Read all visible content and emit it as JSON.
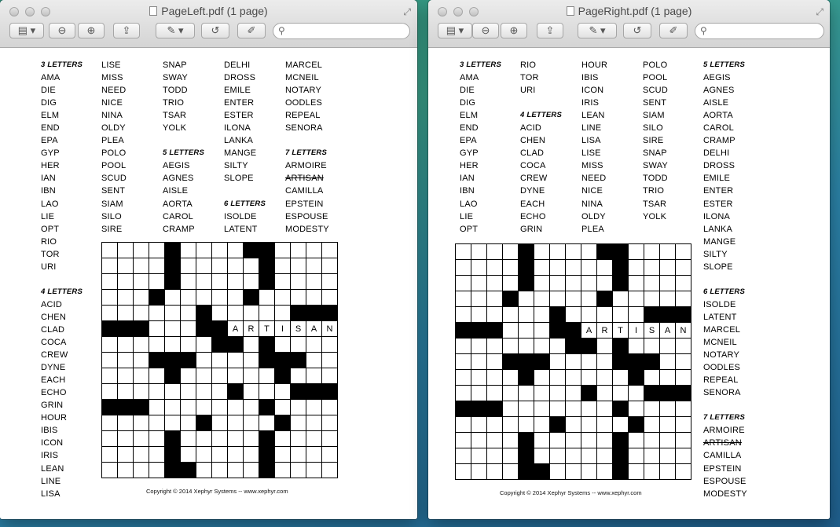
{
  "left_window": {
    "title": "PageLeft.pdf (1 page)",
    "columns": [
      [
        {
          "t": "3 LETTERS",
          "h": true
        },
        {
          "t": "AMA"
        },
        {
          "t": "DIE"
        },
        {
          "t": "DIG"
        },
        {
          "t": "ELM"
        },
        {
          "t": "END"
        },
        {
          "t": "EPA"
        },
        {
          "t": "GYP"
        },
        {
          "t": "HER"
        },
        {
          "t": "IAN"
        },
        {
          "t": "IBN"
        },
        {
          "t": "LAO"
        },
        {
          "t": "LIE"
        },
        {
          "t": "OPT"
        },
        {
          "t": "RIO"
        },
        {
          "t": "TOR"
        },
        {
          "t": "URI"
        },
        {
          "t": ""
        },
        {
          "t": "4 LETTERS",
          "h": true
        },
        {
          "t": "ACID"
        },
        {
          "t": "CHEN"
        },
        {
          "t": "CLAD"
        },
        {
          "t": "COCA"
        },
        {
          "t": "CREW"
        },
        {
          "t": "DYNE"
        },
        {
          "t": "EACH"
        },
        {
          "t": "ECHO"
        },
        {
          "t": "GRIN"
        },
        {
          "t": "HOUR"
        },
        {
          "t": "IBIS"
        },
        {
          "t": "ICON"
        },
        {
          "t": "IRIS"
        },
        {
          "t": "LEAN"
        },
        {
          "t": "LINE"
        },
        {
          "t": "LISA"
        }
      ],
      [
        {
          "t": "LISE"
        },
        {
          "t": "MISS"
        },
        {
          "t": "NEED"
        },
        {
          "t": "NICE"
        },
        {
          "t": "NINA"
        },
        {
          "t": "OLDY"
        },
        {
          "t": "PLEA"
        },
        {
          "t": "POLO"
        },
        {
          "t": "POOL"
        },
        {
          "t": "SCUD"
        },
        {
          "t": "SENT"
        },
        {
          "t": "SIAM"
        },
        {
          "t": "SILO"
        },
        {
          "t": "SIRE"
        }
      ],
      [
        {
          "t": "SNAP"
        },
        {
          "t": "SWAY"
        },
        {
          "t": "TODD"
        },
        {
          "t": "TRIO"
        },
        {
          "t": "TSAR"
        },
        {
          "t": "YOLK"
        },
        {
          "t": ""
        },
        {
          "t": "5 LETTERS",
          "h": true
        },
        {
          "t": "AEGIS"
        },
        {
          "t": "AGNES"
        },
        {
          "t": "AISLE"
        },
        {
          "t": "AORTA"
        },
        {
          "t": "CAROL"
        },
        {
          "t": "CRAMP"
        }
      ],
      [
        {
          "t": "DELHI"
        },
        {
          "t": "DROSS"
        },
        {
          "t": "EMILE"
        },
        {
          "t": "ENTER"
        },
        {
          "t": "ESTER"
        },
        {
          "t": "ILONA"
        },
        {
          "t": "LANKA"
        },
        {
          "t": "MANGE"
        },
        {
          "t": "SILTY"
        },
        {
          "t": "SLOPE"
        },
        {
          "t": ""
        },
        {
          "t": "6 LETTERS",
          "h": true
        },
        {
          "t": "ISOLDE"
        },
        {
          "t": "LATENT"
        }
      ],
      [
        {
          "t": "MARCEL"
        },
        {
          "t": "MCNEIL"
        },
        {
          "t": "NOTARY"
        },
        {
          "t": "OODLES"
        },
        {
          "t": "REPEAL"
        },
        {
          "t": "SENORA"
        },
        {
          "t": ""
        },
        {
          "t": "7 LETTERS",
          "h": true
        },
        {
          "t": "ARMOIRE"
        },
        {
          "t": "ARTISAN",
          "s": true
        },
        {
          "t": "CAMILLA"
        },
        {
          "t": "EPSTEIN"
        },
        {
          "t": "ESPOUSE"
        },
        {
          "t": "MODESTY"
        }
      ]
    ],
    "copyright": "Copyright © 2014 Xephyr Systems -- www.xephyr.com"
  },
  "right_window": {
    "title": "PageRight.pdf (1 page)",
    "columns": [
      [
        {
          "t": "3 LETTERS",
          "h": true
        },
        {
          "t": "AMA"
        },
        {
          "t": "DIE"
        },
        {
          "t": "DIG"
        },
        {
          "t": "ELM"
        },
        {
          "t": "END"
        },
        {
          "t": "EPA"
        },
        {
          "t": "GYP"
        },
        {
          "t": "HER"
        },
        {
          "t": "IAN"
        },
        {
          "t": "IBN"
        },
        {
          "t": "LAO"
        },
        {
          "t": "LIE"
        },
        {
          "t": "OPT"
        }
      ],
      [
        {
          "t": "RIO"
        },
        {
          "t": "TOR"
        },
        {
          "t": "URI"
        },
        {
          "t": ""
        },
        {
          "t": "4 LETTERS",
          "h": true
        },
        {
          "t": "ACID"
        },
        {
          "t": "CHEN"
        },
        {
          "t": "CLAD"
        },
        {
          "t": "COCA"
        },
        {
          "t": "CREW"
        },
        {
          "t": "DYNE"
        },
        {
          "t": "EACH"
        },
        {
          "t": "ECHO"
        },
        {
          "t": "GRIN"
        }
      ],
      [
        {
          "t": "HOUR"
        },
        {
          "t": "IBIS"
        },
        {
          "t": "ICON"
        },
        {
          "t": "IRIS"
        },
        {
          "t": "LEAN"
        },
        {
          "t": "LINE"
        },
        {
          "t": "LISA"
        },
        {
          "t": "LISE"
        },
        {
          "t": "MISS"
        },
        {
          "t": "NEED"
        },
        {
          "t": "NICE"
        },
        {
          "t": "NINA"
        },
        {
          "t": "OLDY"
        },
        {
          "t": "PLEA"
        }
      ],
      [
        {
          "t": "POLO"
        },
        {
          "t": "POOL"
        },
        {
          "t": "SCUD"
        },
        {
          "t": "SENT"
        },
        {
          "t": "SIAM"
        },
        {
          "t": "SILO"
        },
        {
          "t": "SIRE"
        },
        {
          "t": "SNAP"
        },
        {
          "t": "SWAY"
        },
        {
          "t": "TODD"
        },
        {
          "t": "TRIO"
        },
        {
          "t": "TSAR"
        },
        {
          "t": "YOLK"
        }
      ],
      [
        {
          "t": "5 LETTERS",
          "h": true
        },
        {
          "t": "AEGIS"
        },
        {
          "t": "AGNES"
        },
        {
          "t": "AISLE"
        },
        {
          "t": "AORTA"
        },
        {
          "t": "CAROL"
        },
        {
          "t": "CRAMP"
        },
        {
          "t": "DELHI"
        },
        {
          "t": "DROSS"
        },
        {
          "t": "EMILE"
        },
        {
          "t": "ENTER"
        },
        {
          "t": "ESTER"
        },
        {
          "t": "ILONA"
        },
        {
          "t": "LANKA"
        },
        {
          "t": "MANGE"
        },
        {
          "t": "SILTY"
        },
        {
          "t": "SLOPE"
        },
        {
          "t": ""
        },
        {
          "t": "6 LETTERS",
          "h": true
        },
        {
          "t": "ISOLDE"
        },
        {
          "t": "LATENT"
        },
        {
          "t": "MARCEL"
        },
        {
          "t": "MCNEIL"
        },
        {
          "t": "NOTARY"
        },
        {
          "t": "OODLES"
        },
        {
          "t": "REPEAL"
        },
        {
          "t": "SENORA"
        },
        {
          "t": ""
        },
        {
          "t": "7 LETTERS",
          "h": true
        },
        {
          "t": "ARMOIRE"
        },
        {
          "t": "ARTISAN",
          "s": true
        },
        {
          "t": "CAMILLA"
        },
        {
          "t": "EPSTEIN"
        },
        {
          "t": "ESPOUSE"
        },
        {
          "t": "MODESTY"
        }
      ]
    ],
    "copyright": "Copyright © 2014 Xephyr Systems -- www.xephyr.com"
  },
  "grid": {
    "rows": [
      "....#....##....",
      "....#.....#....",
      "....#.....#....",
      "...#.....#.....",
      "......#.....###",
      "###...##ARTISAN",
      ".......##.#....",
      "...###....###..",
      "....#......#...",
      "........#...###",
      "###.......#....",
      "......#....#...",
      "....#.....#....",
      "....#.....#....",
      "....##....#...."
    ]
  }
}
